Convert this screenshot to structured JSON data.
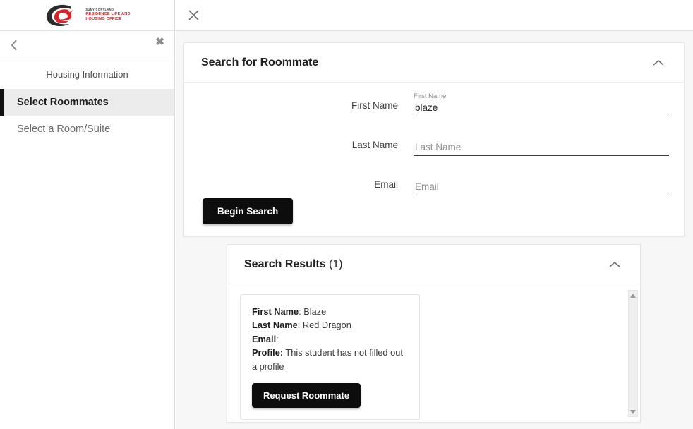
{
  "sidebar": {
    "logo": {
      "icon": "dragon-logo-icon",
      "line1": "SUNY CORTLAND",
      "line2": "RESIDENCE LIFE AND",
      "line3": "HOUSING OFFICE",
      "brand_color": "#d6232a"
    },
    "back_icon": "chevron-left-icon",
    "close_icon": "close-icon",
    "close_glyph": "✖",
    "section_title": "Housing Information",
    "items": [
      {
        "label": "Select Roommates",
        "active": true
      },
      {
        "label": "Select a Room/Suite",
        "active": false
      }
    ]
  },
  "topbar": {
    "close_icon": "close-icon"
  },
  "search_panel": {
    "title": "Search for Roommate",
    "collapse_icon": "chevron-up-icon",
    "fields": [
      {
        "label": "First Name",
        "float_label": "First Name",
        "placeholder": "First Name",
        "value": "blaze"
      },
      {
        "label": "Last Name",
        "float_label": "",
        "placeholder": "Last Name",
        "value": ""
      },
      {
        "label": "Email",
        "float_label": "",
        "placeholder": "Email",
        "value": ""
      }
    ],
    "submit_label": "Begin Search"
  },
  "results_panel": {
    "title": "Search Results",
    "count": "(1)",
    "collapse_icon": "chevron-up-icon",
    "scrollbar": {
      "up_icon": "scroll-up-arrow-icon",
      "down_icon": "scroll-down-arrow-icon"
    },
    "cards": [
      {
        "first_name_label": "First Name",
        "first_name_value": ": Blaze",
        "last_name_label": "Last Name",
        "last_name_value": ": Red Dragon",
        "email_label": "Email",
        "email_value": ":",
        "profile_label": "Profile:",
        "profile_value": " This student has not filled out a profile",
        "action_label": "Request Roommate"
      }
    ]
  }
}
